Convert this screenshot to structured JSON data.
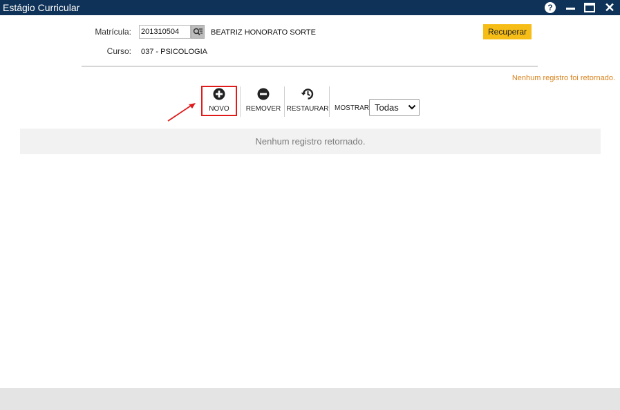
{
  "window": {
    "title": "Estágio Curricular"
  },
  "form": {
    "matricula_label": "Matrícula:",
    "matricula_value": "201310504",
    "student_name": "BEATRIZ HONORATO SORTE",
    "curso_label": "Curso:",
    "curso_value": "037 - PSICOLOGIA",
    "recuperar_label": "Recuperar"
  },
  "status": {
    "top_message": "Nenhum registro foi retornado."
  },
  "toolbar": {
    "novo_label": "NOVO",
    "remover_label": "REMOVER",
    "restaurar_label": "RESTAURAR",
    "mostrar_label": "MOSTRAR:",
    "mostrar_value": "Todas"
  },
  "grid": {
    "empty_message": "Nenhum registro retornado."
  },
  "colors": {
    "titlebar": "#0f3358",
    "accent_button": "#f5bd16",
    "highlight": "#e01b1b",
    "status_text": "#d9821b"
  }
}
